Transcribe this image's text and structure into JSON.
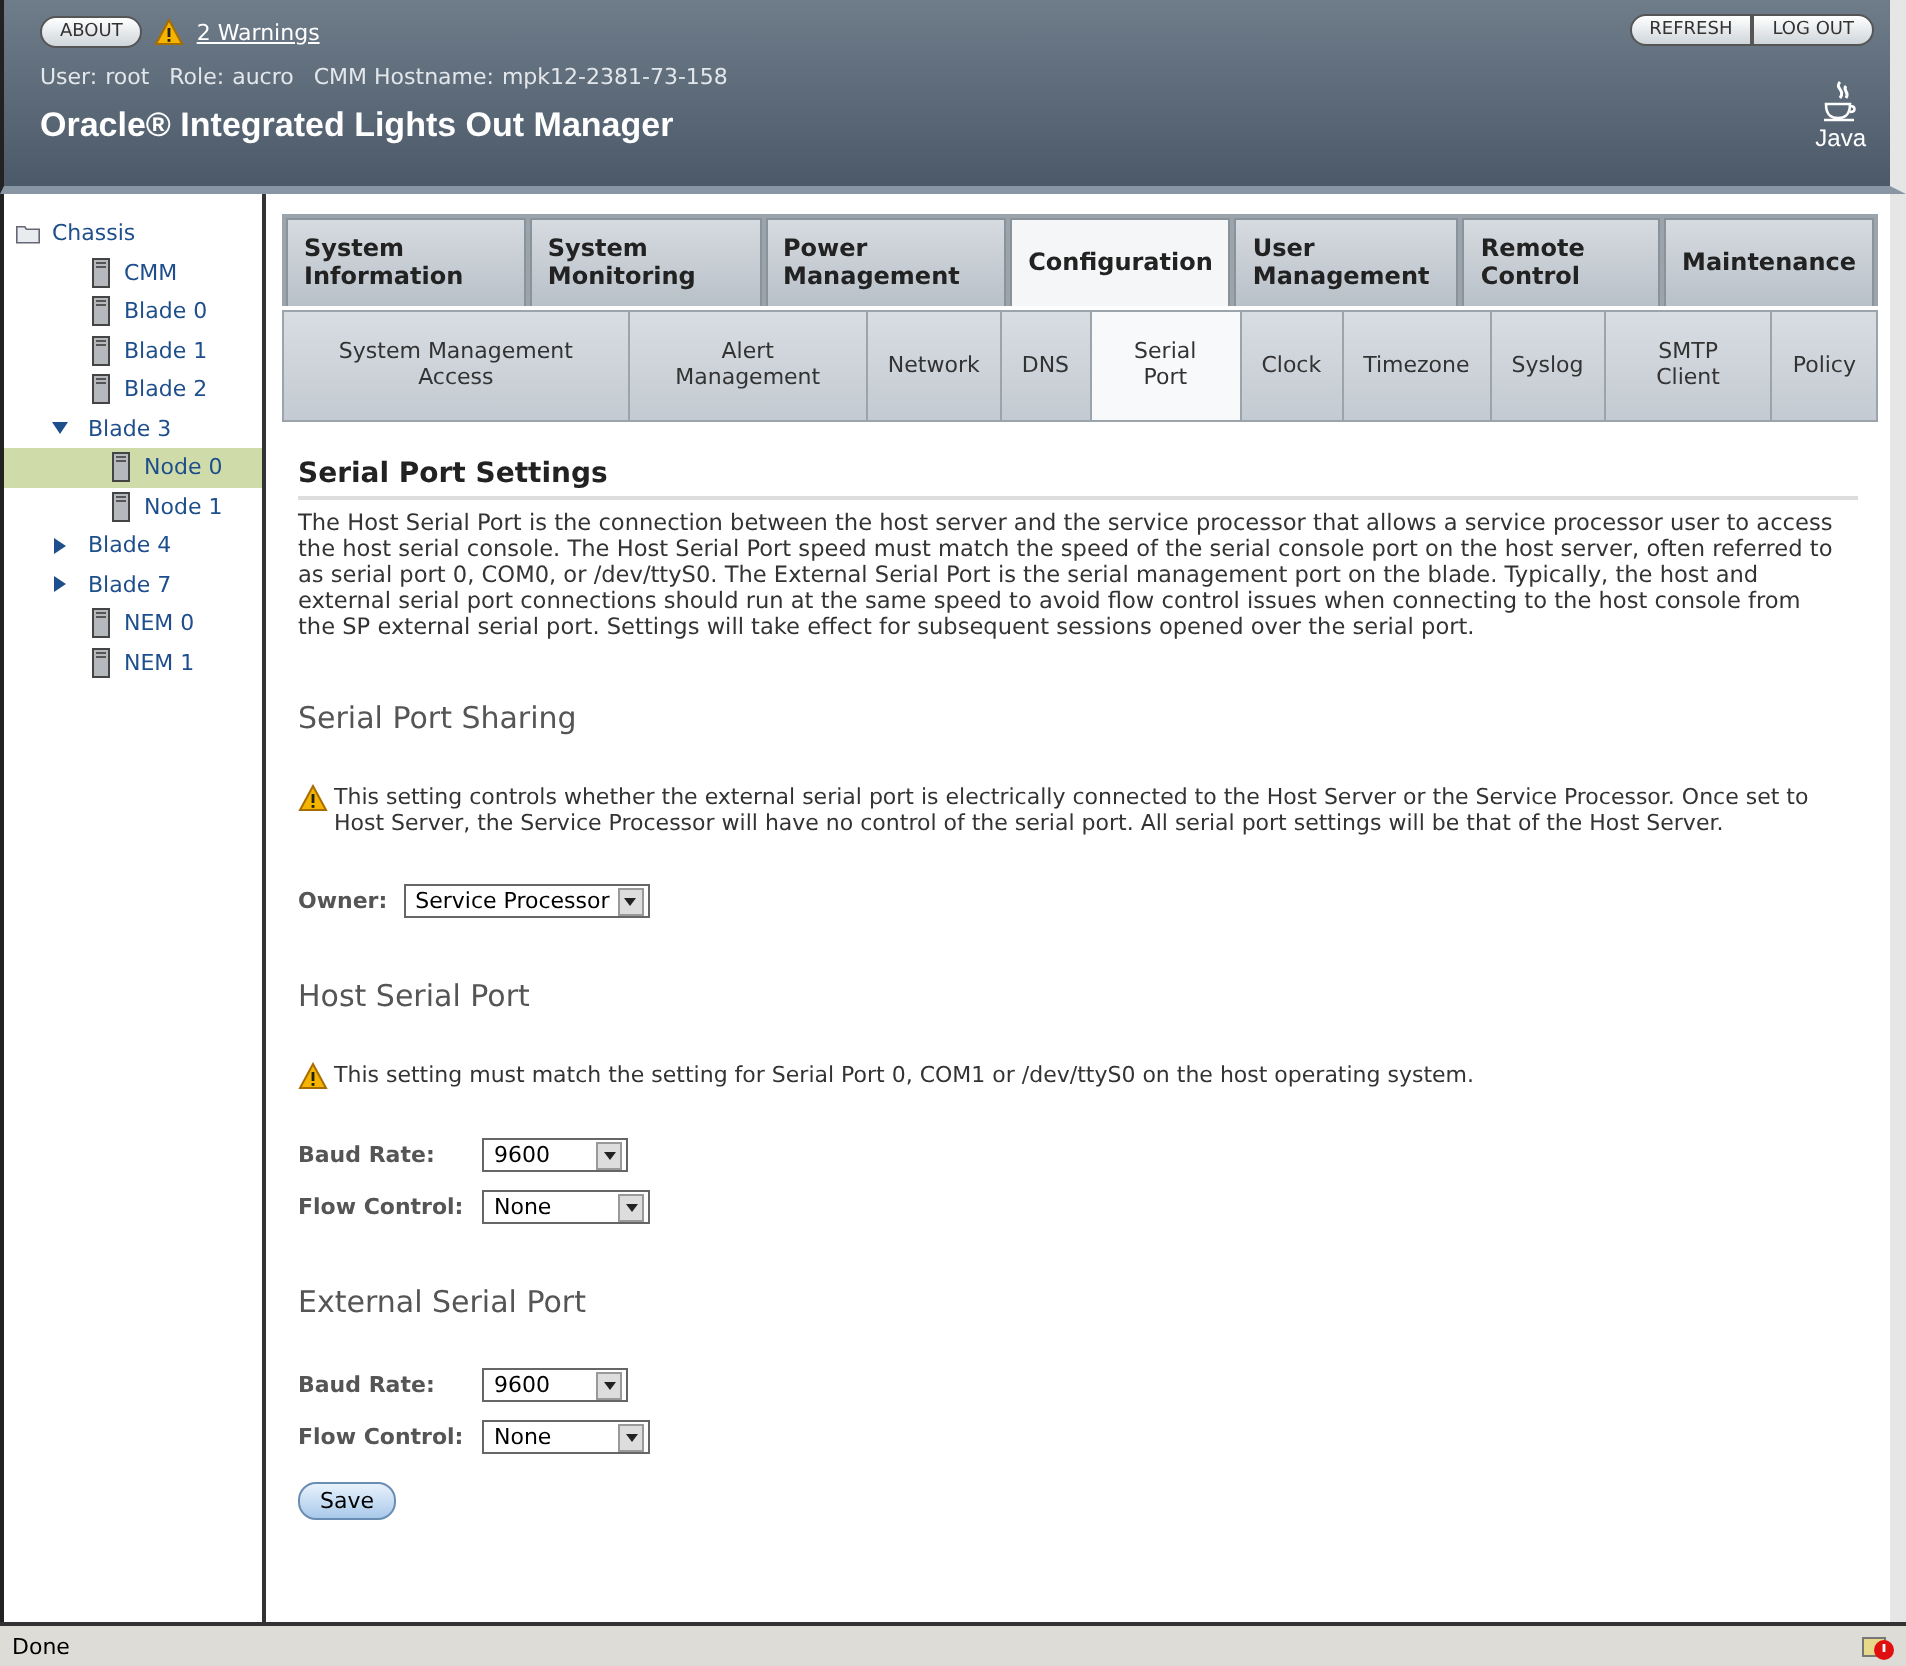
{
  "header": {
    "about": "ABOUT",
    "warnings": "2 Warnings",
    "user_label": "User:",
    "user": "root",
    "role_label": "Role:",
    "role": "aucro",
    "host_label": "CMM Hostname:",
    "host": "mpk12-2381-73-158",
    "title": "Oracle® Integrated Lights Out Manager",
    "buttons": [
      "REFRESH",
      "LOG OUT"
    ],
    "logo_text": "Java"
  },
  "tree": {
    "label": "Chassis",
    "kind": "folder",
    "selected": false,
    "children": [
      {
        "label": "CMM",
        "kind": "server",
        "selected": false
      },
      {
        "label": "Blade 0",
        "kind": "server",
        "selected": false
      },
      {
        "label": "Blade 1",
        "kind": "server",
        "selected": false
      },
      {
        "label": "Blade 2",
        "kind": "server",
        "selected": false
      },
      {
        "label": "Blade 3",
        "kind": "group",
        "expanded": true,
        "selected": false,
        "children": [
          {
            "label": "Node 0",
            "kind": "server",
            "selected": true
          },
          {
            "label": "Node 1",
            "kind": "server",
            "selected": false
          }
        ]
      },
      {
        "label": "Blade 4",
        "kind": "group",
        "expanded": false,
        "selected": false
      },
      {
        "label": "Blade 7",
        "kind": "group",
        "expanded": false,
        "selected": false
      },
      {
        "label": "NEM 0",
        "kind": "server",
        "selected": false
      },
      {
        "label": "NEM 1",
        "kind": "server",
        "selected": false
      }
    ]
  },
  "tabs": [
    {
      "label": "System Information",
      "selected": false
    },
    {
      "label": "System Monitoring",
      "selected": false
    },
    {
      "label": "Power Management",
      "selected": false
    },
    {
      "label": "Configuration",
      "selected": true
    },
    {
      "label": "User Management",
      "selected": false
    },
    {
      "label": "Remote Control",
      "selected": false
    },
    {
      "label": "Maintenance",
      "selected": false
    }
  ],
  "subtabs": [
    {
      "label": "System Management Access",
      "selected": false
    },
    {
      "label": "Alert Management",
      "selected": false
    },
    {
      "label": "Network",
      "selected": false
    },
    {
      "label": "DNS",
      "selected": false
    },
    {
      "label": "Serial Port",
      "selected": true
    },
    {
      "label": "Clock",
      "selected": false
    },
    {
      "label": "Timezone",
      "selected": false
    },
    {
      "label": "Syslog",
      "selected": false
    },
    {
      "label": "SMTP Client",
      "selected": false
    },
    {
      "label": "Policy",
      "selected": false
    }
  ],
  "page": {
    "title": "Serial Port Settings",
    "intro": "The Host Serial Port is the connection between the host server and the service processor that allows a service processor user to access the host serial console. The Host Serial Port speed must match the speed of the serial console port on the host server, often referred to as serial port 0, COM0, or /dev/ttyS0. The External Serial Port is the serial management port on the blade. Typically, the host and external serial port connections should run at the same speed to avoid flow control issues when connecting to the host console from the SP external serial port. Settings will take effect for subsequent sessions opened over the serial port.",
    "sections": [
      {
        "title": "Serial Port Sharing",
        "warning": "This setting controls whether the external serial port is electrically connected to the Host Server or the Service Processor. Once set to Host Server, the Service Processor will have no control of the serial port. All serial port settings will be that of the Host Server.",
        "fields": [
          {
            "label": "Owner:",
            "value": "Service Processor"
          }
        ]
      },
      {
        "title": "Host Serial Port",
        "warning": "This setting must match the setting for Serial Port 0, COM1 or /dev/ttyS0 on the host operating system.",
        "fields": [
          {
            "label": "Baud Rate:",
            "value": "9600"
          },
          {
            "label": "Flow Control:",
            "value": "None"
          }
        ]
      },
      {
        "title": "External Serial Port",
        "fields": [
          {
            "label": "Baud Rate:",
            "value": "9600"
          },
          {
            "label": "Flow Control:",
            "value": "None"
          }
        ]
      }
    ],
    "save": "Save"
  },
  "status_bar": {
    "text": "Done"
  }
}
